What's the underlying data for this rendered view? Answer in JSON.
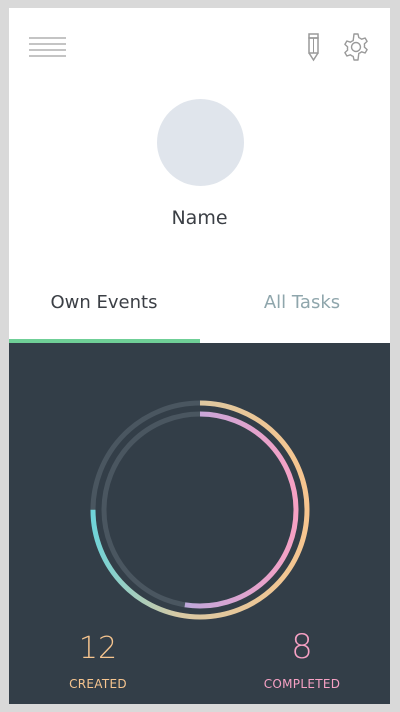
{
  "header": {
    "menu_icon": "hamburger-menu-icon",
    "edit_icon": "pencil-icon",
    "settings_icon": "gear-icon"
  },
  "profile": {
    "name": "Name"
  },
  "tabs": [
    {
      "label": "Own Events",
      "active": true
    },
    {
      "label": "All Tasks",
      "active": false
    }
  ],
  "stats": {
    "created": {
      "value": "12",
      "label": "CREATED"
    },
    "completed": {
      "value": "8",
      "label": "COMPLETED"
    }
  },
  "colors": {
    "tab_indicator": "#6fcf97",
    "stats_background": "#333e48",
    "created_accent": "#f7c58f",
    "completed_accent": "#f7a1c4",
    "ring_track": "#4a5660"
  },
  "chart_data": {
    "type": "pie",
    "series": [
      {
        "name": "CREATED",
        "value": 12
      },
      {
        "name": "COMPLETED",
        "value": 8
      }
    ]
  }
}
